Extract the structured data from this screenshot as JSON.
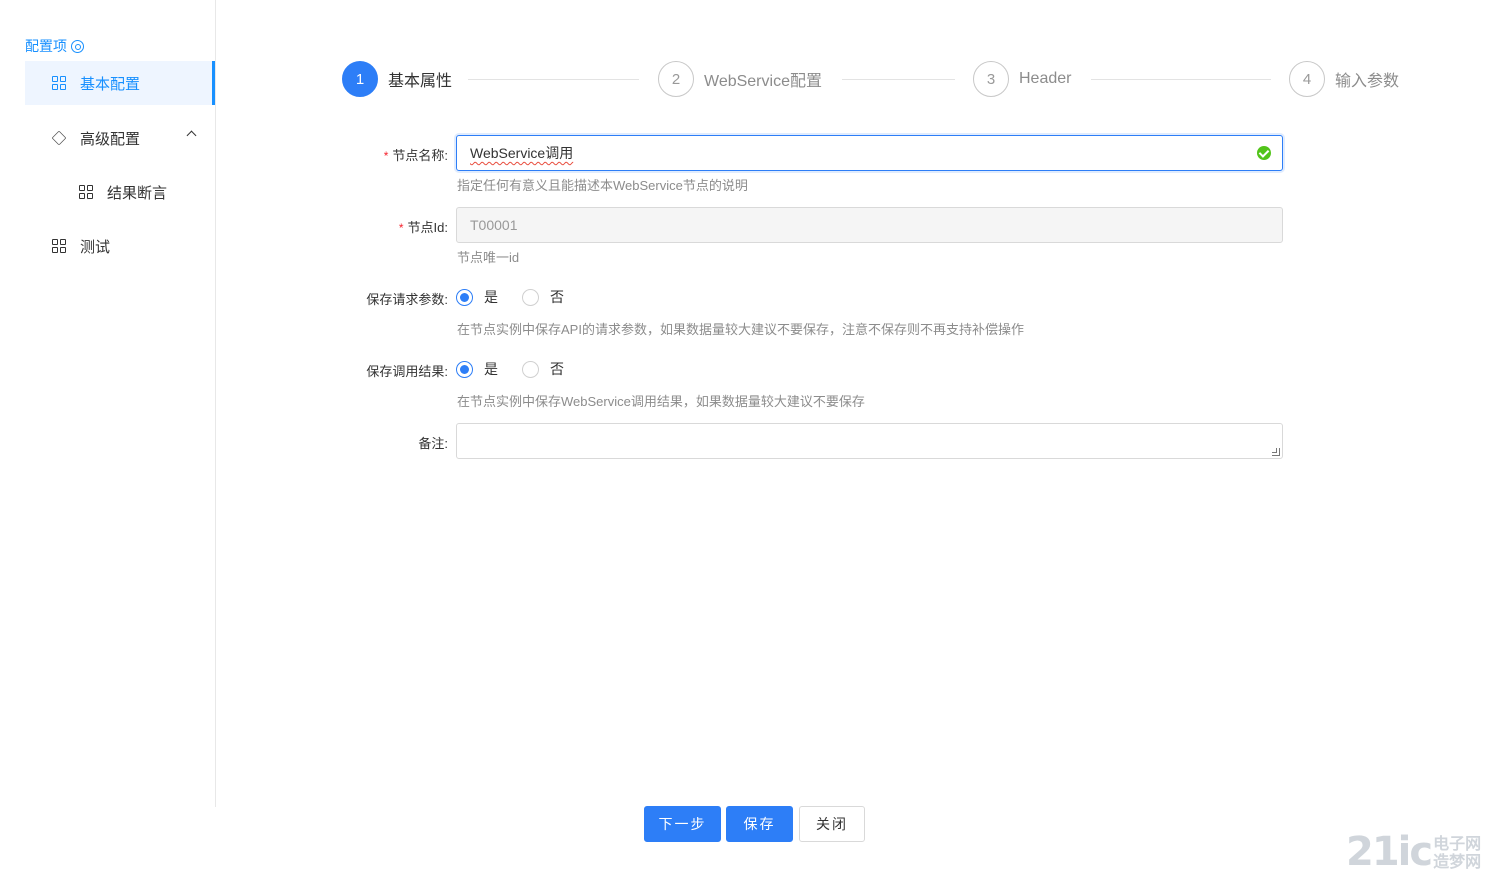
{
  "sidebar": {
    "title": "配置项",
    "items": [
      {
        "label": "基本配置",
        "active": true
      },
      {
        "label": "高级配置",
        "expanded": true
      },
      {
        "label": "结果断言"
      },
      {
        "label": "测试"
      }
    ]
  },
  "steps": [
    {
      "number": "1",
      "label": "基本属性",
      "active": true
    },
    {
      "number": "2",
      "label": "WebService配置"
    },
    {
      "number": "3",
      "label": "Header"
    },
    {
      "number": "4",
      "label": "输入参数"
    }
  ],
  "form": {
    "node_name": {
      "label": "节点名称:",
      "value": "WebService调用",
      "help": "指定任何有意义且能描述本WebService节点的说明"
    },
    "node_id": {
      "label": "节点Id:",
      "value": "T00001",
      "help": "节点唯一id"
    },
    "save_request": {
      "label": "保存请求参数:",
      "yes": "是",
      "no": "否",
      "selected": "是",
      "help": "在节点实例中保存API的请求参数，如果数据量较大建议不要保存，注意不保存则不再支持补偿操作"
    },
    "save_result": {
      "label": "保存调用结果:",
      "yes": "是",
      "no": "否",
      "selected": "是",
      "help": "在节点实例中保存WebService调用结果，如果数据量较大建议不要保存"
    },
    "remark": {
      "label": "备注:",
      "value": ""
    }
  },
  "footer": {
    "next": "下一步",
    "save": "保存",
    "close": "关闭"
  },
  "watermark": {
    "big": "21ic",
    "line1": "电子网",
    "line2": "造梦网"
  },
  "colors": {
    "primary": "#2d7ef7",
    "success": "#52c41a",
    "required": "#f5222d"
  }
}
